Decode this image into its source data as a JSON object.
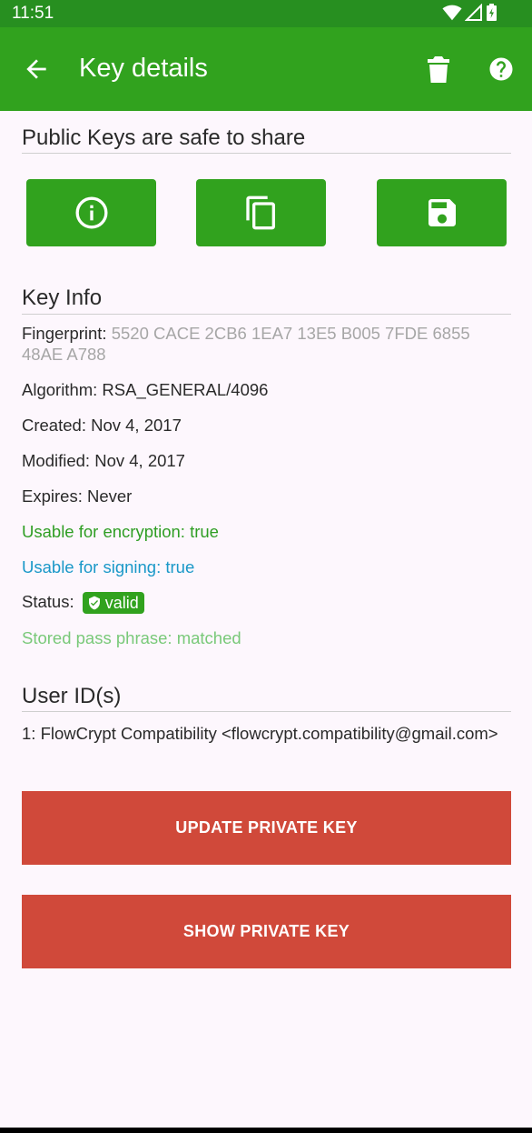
{
  "status_bar": {
    "time": "11:51"
  },
  "app_bar": {
    "title": "Key details"
  },
  "public_keys_section": {
    "title": "Public Keys are safe to share"
  },
  "key_info": {
    "title": "Key Info",
    "fingerprint_label": "Fingerprint:",
    "fingerprint_value": "5520 CACE 2CB6 1EA7 13E5 B005 7FDE 6855 48AE A788",
    "algorithm": "Algorithm: RSA_GENERAL/4096",
    "created": "Created: Nov 4, 2017",
    "modified": "Modified: Nov 4, 2017",
    "expires": "Expires: Never",
    "usable_encryption": "Usable for encryption: true",
    "usable_signing": "Usable for signing: true",
    "status_label": "Status:",
    "status_badge": "valid",
    "stored_pass_phrase": "Stored pass phrase: matched"
  },
  "user_ids": {
    "title": "User ID(s)",
    "items": [
      "1: FlowCrypt Compatibility <flowcrypt.compatibility@gmail.com>"
    ]
  },
  "actions": {
    "update_private_key": "UPDATE PRIVATE KEY",
    "show_private_key": "SHOW PRIVATE KEY"
  },
  "colors": {
    "app_bar": "#31a21e",
    "status_bar": "#278f20",
    "action_button": "#d0493a",
    "encryption_text": "#2f9e24",
    "signing_text": "#1a98c8",
    "pass_phrase_text": "#79c979"
  },
  "icons": [
    "wifi-icon",
    "signal-icon",
    "battery-icon",
    "back-arrow-icon",
    "delete-icon",
    "help-icon",
    "info-icon",
    "copy-icon",
    "save-icon",
    "shield-check-icon"
  ]
}
